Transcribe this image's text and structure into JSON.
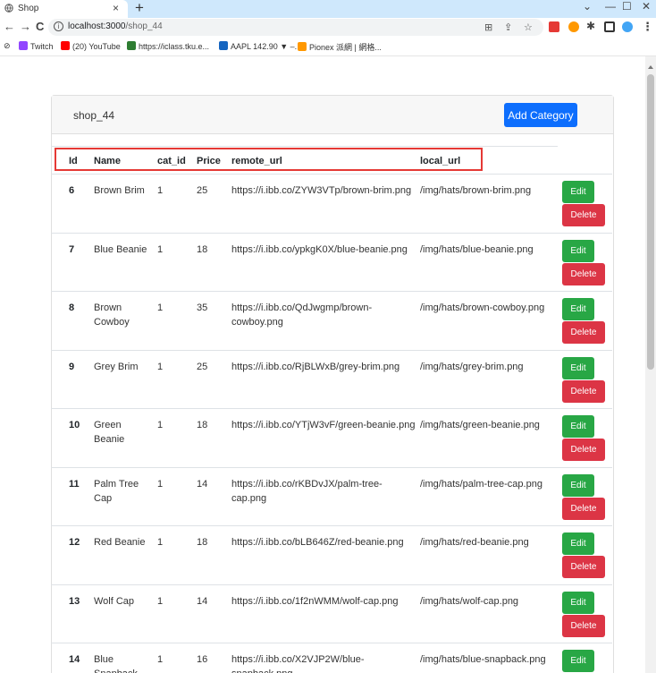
{
  "browser": {
    "tab_title": "Shop",
    "tab_close": "×",
    "new_tab": "+",
    "win_min": "—",
    "win_max": "☐",
    "win_close": "✕",
    "win_chevron": "⌄",
    "url_host": "localhost:3000",
    "url_path": "/shop_44",
    "bookmarks": [
      {
        "label": "Twitch",
        "color": "#9146ff"
      },
      {
        "label": "(20) YouTube",
        "color": "#ff0000"
      },
      {
        "label": "https://iclass.tku.e...",
        "color": "#2e7d32"
      },
      {
        "label": "AAPL 142.90 ▼ –...",
        "color": "#1565c0"
      },
      {
        "label": "Pionex 派網 | 網格...",
        "color": "#ff9800"
      }
    ]
  },
  "page": {
    "shop_name": "shop_44",
    "add_button": "Add Category",
    "edit_label": "Edit",
    "delete_label": "Delete",
    "columns": [
      "Id",
      "Name",
      "cat_id",
      "Price",
      "remote_url",
      "local_url"
    ],
    "rows": [
      {
        "id": "6",
        "name": [
          "Brown Brim"
        ],
        "cat_id": "1",
        "price": "25",
        "remote": [
          "https://i.ibb.co/ZYW3VTp/brown-brim.png"
        ],
        "local": "/img/hats/brown-brim.png"
      },
      {
        "id": "7",
        "name": [
          "Blue Beanie"
        ],
        "cat_id": "1",
        "price": "18",
        "remote": [
          "https://i.ibb.co/ypkgK0X/blue-beanie.png"
        ],
        "local": "/img/hats/blue-beanie.png"
      },
      {
        "id": "8",
        "name": [
          "Brown",
          "Cowboy"
        ],
        "cat_id": "1",
        "price": "35",
        "remote": [
          "https://i.ibb.co/QdJwgmp/brown-",
          "cowboy.png"
        ],
        "local": "/img/hats/brown-cowboy.png"
      },
      {
        "id": "9",
        "name": [
          "Grey Brim"
        ],
        "cat_id": "1",
        "price": "25",
        "remote": [
          "https://i.ibb.co/RjBLWxB/grey-brim.png"
        ],
        "local": "/img/hats/grey-brim.png"
      },
      {
        "id": "10",
        "name": [
          "Green",
          "Beanie"
        ],
        "cat_id": "1",
        "price": "18",
        "remote": [
          "https://i.ibb.co/YTjW3vF/green-beanie.png"
        ],
        "local": "/img/hats/green-beanie.png"
      },
      {
        "id": "11",
        "name": [
          "Palm Tree",
          "Cap"
        ],
        "cat_id": "1",
        "price": "14",
        "remote": [
          "https://i.ibb.co/rKBDvJX/palm-tree-",
          "cap.png"
        ],
        "local": "/img/hats/palm-tree-cap.png"
      },
      {
        "id": "12",
        "name": [
          "Red Beanie"
        ],
        "cat_id": "1",
        "price": "18",
        "remote": [
          "https://i.ibb.co/bLB646Z/red-beanie.png"
        ],
        "local": "/img/hats/red-beanie.png"
      },
      {
        "id": "13",
        "name": [
          "Wolf Cap"
        ],
        "cat_id": "1",
        "price": "14",
        "remote": [
          "https://i.ibb.co/1f2nWMM/wolf-cap.png"
        ],
        "local": "/img/hats/wolf-cap.png"
      },
      {
        "id": "14",
        "name": [
          "Blue",
          "Snapback"
        ],
        "cat_id": "1",
        "price": "16",
        "remote": [
          "https://i.ibb.co/X2VJP2W/blue-",
          "snapback.png"
        ],
        "local": "/img/hats/blue-snapback.png"
      }
    ]
  }
}
